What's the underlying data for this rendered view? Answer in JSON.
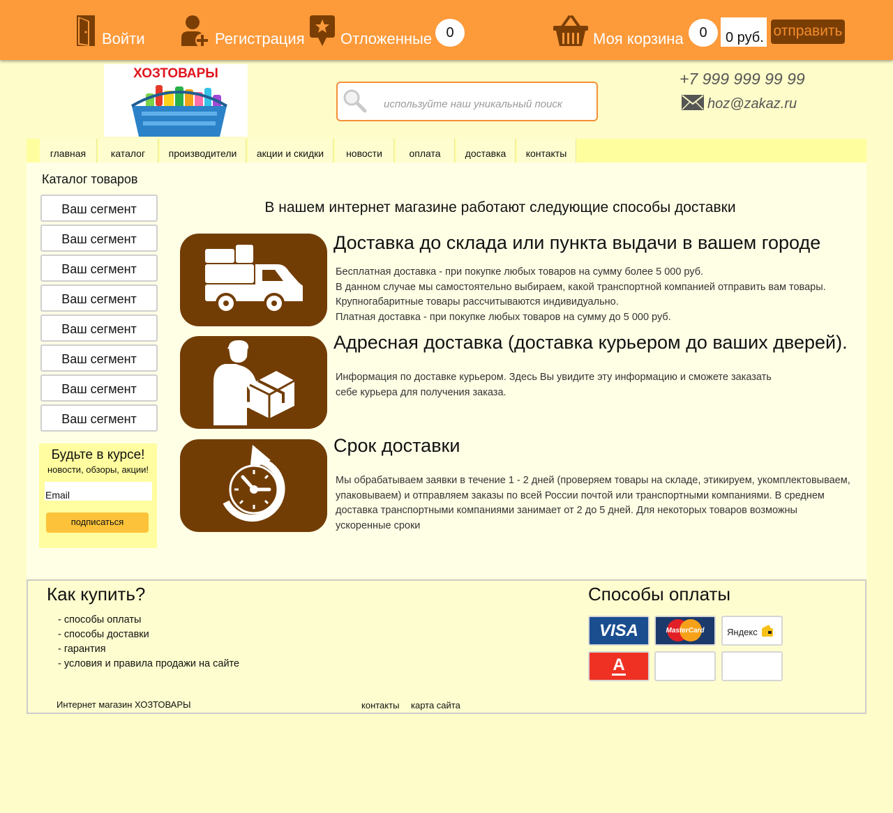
{
  "topbar": {
    "login": "Войти",
    "register": "Регистрация",
    "deferred": "Отложенные",
    "deferred_count": "0",
    "cart": "Моя корзина",
    "cart_count": "0",
    "cart_sum": "0 руб.",
    "send": "отправить"
  },
  "header": {
    "logo_text": "ХОЗТОВАРЫ",
    "search_placeholder": "используйте наш уникальный поиск",
    "phone": "+7 999 999 99 99",
    "email": "hoz@zakaz.ru"
  },
  "nav": {
    "items": [
      "главная",
      "каталог",
      "производители",
      "акции и скидки",
      "новости",
      "оплата",
      "доставка",
      "контакты"
    ]
  },
  "sidebar": {
    "catalog_title": "Каталог товаров",
    "segments": [
      "Ваш сегмент",
      "Ваш сегмент",
      "Ваш сегмент",
      "Ваш сегмент",
      "Ваш сегмент",
      "Ваш сегмент",
      "Ваш сегмент",
      "Ваш сегмент"
    ],
    "subscribe": {
      "title": "Будьте в курсе!",
      "subtitle": "новости, обзоры, акции!",
      "email_placeholder": "Email",
      "button": "подписаться"
    }
  },
  "content": {
    "title": "В нашем интернет магазине работают следующие способы доставки",
    "sections": [
      {
        "icon": "truck-icon",
        "title": "Доставка до склада или пункта выдачи в вашем городе",
        "lines": [
          "Бесплатная доставка - при покупке любых товаров на сумму более 5 000 руб.",
          "В данном случае мы самостоятельно выбираем, какой транспортной компанией отправить вам товары.",
          "Крупногабаритные товары рассчитываются индивидуально.",
          "Платная доставка - при покупке любых товаров на сумму до 5 000 руб."
        ]
      },
      {
        "icon": "courier-icon",
        "title": "Адресная доставка (доставка курьером до ваших дверей).",
        "lines": [
          "Информация по доставке курьером. Здесь Вы увидите эту информацию и сможете заказать",
          "себе курьера для получения заказа."
        ]
      },
      {
        "icon": "clock-icon",
        "title": "Срок доставки",
        "lines": [
          "Мы обрабатываем заявки в течение 1 - 2 дней (проверяем товары на складе, этикируем, укомплектовываем,",
          "упаковываем) и отправляем заказы по всей России почтой или транспортными компаниями. В среднем",
          "доставка транспортными компаниями занимает от 2 до 5 дней. Для некоторых товаров возможны",
          "ускоренные сроки"
        ]
      }
    ]
  },
  "footer": {
    "how_to_buy_title": "Как купить?",
    "how_to_buy_items": [
      "- способы оплаты",
      "- способы доставки",
      "- гарантия",
      "- условия и правила продажи на сайте"
    ],
    "shop_name": "Интернет магазин ХОЗТОВАРЫ",
    "links": [
      "контакты",
      "карта сайта"
    ],
    "payment_title": "Способы оплаты",
    "payment_methods": [
      "VISA",
      "MasterCard",
      "Яндекс",
      "А"
    ]
  },
  "colors": {
    "topbar": "#fd9a3a",
    "brown": "#723d05",
    "page_bg": "#fefcc9",
    "nav_bg": "#fffe9f",
    "subscribe_btn": "#fcc33a"
  }
}
